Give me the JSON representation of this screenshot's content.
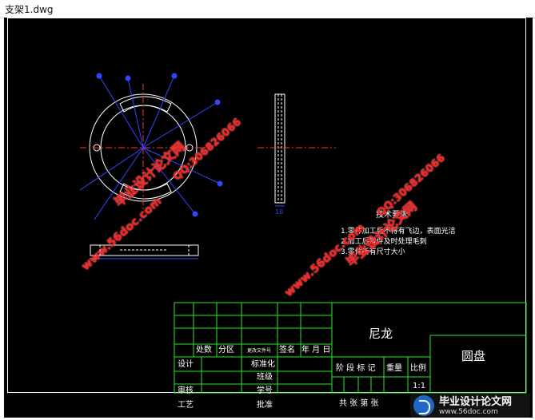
{
  "window": {
    "title": "支架1.dwg"
  },
  "drawing": {
    "notes": {
      "heading": "技术要求",
      "items": [
        "1.零件加工后不得有飞边，表面光洁",
        "2.加工后零件及时处理毛刺",
        "3.零件所有尺寸大小"
      ]
    },
    "dim_label": "10"
  },
  "title_block": {
    "material": "尼龙",
    "part_name": "圆盘",
    "change_headers": [
      "处数",
      "分区",
      "更改文件号",
      "签名",
      "年 月 日"
    ],
    "left_rows": [
      "设计",
      "审核",
      "工艺"
    ],
    "mid_rows": [
      "标准化",
      "班级",
      "学号",
      "批准"
    ],
    "stage_label": "阶 段 标 记",
    "weight_label": "重量",
    "scale_label": "比例",
    "scale_value": "1:1",
    "sheet_text": "共  张  第  张"
  },
  "watermarks": [
    {
      "kind": "url",
      "text": "www.56doc.com"
    },
    {
      "kind": "qq",
      "text": "QQ:306826066"
    },
    {
      "kind": "cn",
      "text": "毕业设计论文网"
    },
    {
      "kind": "url",
      "text": "www.56doc.com"
    },
    {
      "kind": "qq",
      "text": "QQ:306826066"
    },
    {
      "kind": "cn",
      "text": "毕业设计论文网"
    }
  ],
  "logo": {
    "line1": "毕业设计论文网",
    "line2": "www.56doc.com"
  },
  "colors": {
    "background": "#000000",
    "line": "#ffffff",
    "center_line": "#ff3333",
    "dimension": "#3344ff",
    "table_line": "#2ee62e",
    "watermark": "#ff1f1f"
  }
}
